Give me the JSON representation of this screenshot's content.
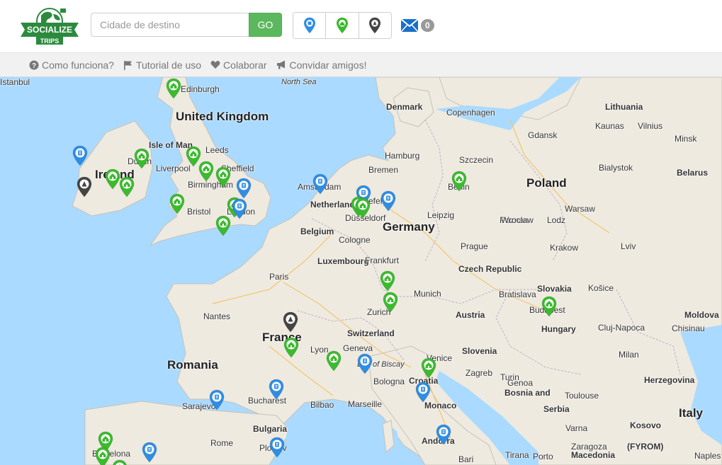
{
  "brand": {
    "logo_top": "SOCIALIZE",
    "logo_bottom": "TRIPS"
  },
  "search": {
    "placeholder": "Cidade de destino",
    "go_label": "GO"
  },
  "filters": [
    {
      "name": "hostel-filter",
      "color": "#2f8de4"
    },
    {
      "name": "home-filter",
      "color": "#3cba2f"
    },
    {
      "name": "event-filter",
      "color": "#444444"
    }
  ],
  "messages": {
    "count": "0",
    "color": "#1a6fc9"
  },
  "subnav": [
    {
      "label": "Como funciona?",
      "icon": "question-circle-icon"
    },
    {
      "label": "Tutorial de uso",
      "icon": "flag-icon"
    },
    {
      "label": "Colaborar",
      "icon": "heart-icon"
    },
    {
      "label": "Convidar amigos!",
      "icon": "bullhorn-icon"
    }
  ],
  "map": {
    "labels": [
      {
        "text": "North Sea",
        "cls": "sea"
      },
      {
        "text": "Edinburgh",
        "cls": "city"
      },
      {
        "text": "United Kingdom",
        "cls": "big"
      },
      {
        "text": "Isle of Man",
        "cls": "region"
      },
      {
        "text": "Leeds",
        "cls": "city"
      },
      {
        "text": "Dublin",
        "cls": "city"
      },
      {
        "text": "Ireland",
        "cls": "country"
      },
      {
        "text": "Liverpool",
        "cls": "city"
      },
      {
        "text": "Sheffield",
        "cls": "city"
      },
      {
        "text": "Birmingham",
        "cls": "city"
      },
      {
        "text": "Bristol",
        "cls": "city"
      },
      {
        "text": "London",
        "cls": "city"
      },
      {
        "text": "Denmark",
        "cls": "region"
      },
      {
        "text": "Copenhagen",
        "cls": "city"
      },
      {
        "text": "Lithuania",
        "cls": "region"
      },
      {
        "text": "Kaunas",
        "cls": "city"
      },
      {
        "text": "Vilnius",
        "cls": "city"
      },
      {
        "text": "Gdansk",
        "cls": "city"
      },
      {
        "text": "Minsk",
        "cls": "city"
      },
      {
        "text": "Hamburg",
        "cls": "city"
      },
      {
        "text": "Szczecin",
        "cls": "city"
      },
      {
        "text": "Bremen",
        "cls": "city"
      },
      {
        "text": "Bialystok",
        "cls": "city"
      },
      {
        "text": "Belarus",
        "cls": "region"
      },
      {
        "text": "Amsterdam",
        "cls": "city"
      },
      {
        "text": "Netherlands",
        "cls": "region"
      },
      {
        "text": "Berlin",
        "cls": "city"
      },
      {
        "text": "Poland",
        "cls": "country"
      },
      {
        "text": "Bielefeld",
        "cls": "city"
      },
      {
        "text": "Düsseldorf",
        "cls": "city"
      },
      {
        "text": "Leipzig",
        "cls": "city"
      },
      {
        "text": "Poznan",
        "cls": "city"
      },
      {
        "text": "Warsaw",
        "cls": "city"
      },
      {
        "text": "Belgium",
        "cls": "region"
      },
      {
        "text": "Germany",
        "cls": "country"
      },
      {
        "text": "Wroclaw",
        "cls": "city"
      },
      {
        "text": "Lodz",
        "cls": "city"
      },
      {
        "text": "Cologne",
        "cls": "city"
      },
      {
        "text": "Prague",
        "cls": "city"
      },
      {
        "text": "Krakow",
        "cls": "city"
      },
      {
        "text": "Lviv",
        "cls": "city"
      },
      {
        "text": "Luxembourg",
        "cls": "region"
      },
      {
        "text": "Frankfurt",
        "cls": "city"
      },
      {
        "text": "Czech Republic",
        "cls": "region"
      },
      {
        "text": "Paris",
        "cls": "city"
      },
      {
        "text": "Slovakia",
        "cls": "region"
      },
      {
        "text": "Košice",
        "cls": "city"
      },
      {
        "text": "Munich",
        "cls": "city"
      },
      {
        "text": "Bratislava",
        "cls": "city"
      },
      {
        "text": "Budapest",
        "cls": "city"
      },
      {
        "text": "Nantes",
        "cls": "city"
      },
      {
        "text": "Zurich",
        "cls": "city"
      },
      {
        "text": "Austria",
        "cls": "region"
      },
      {
        "text": "Moldova",
        "cls": "region"
      },
      {
        "text": "Hungary",
        "cls": "region"
      },
      {
        "text": "Chisinau",
        "cls": "city"
      },
      {
        "text": "Cluj-Napoca",
        "cls": "city"
      },
      {
        "text": "Switzerland",
        "cls": "region"
      },
      {
        "text": "France",
        "cls": "country"
      },
      {
        "text": "Geneva",
        "cls": "city"
      },
      {
        "text": "Lyon",
        "cls": "city"
      },
      {
        "text": "Slovenia",
        "cls": "region"
      },
      {
        "text": "Venice",
        "cls": "city"
      },
      {
        "text": "Milan",
        "cls": "city"
      },
      {
        "text": "Romania",
        "cls": "country"
      },
      {
        "text": "Bay of Biscay",
        "cls": "sea"
      },
      {
        "text": "Turin",
        "cls": "city"
      },
      {
        "text": "Zagreb",
        "cls": "city"
      },
      {
        "text": "Croatia",
        "cls": "region"
      },
      {
        "text": "Bologna",
        "cls": "city"
      },
      {
        "text": "Genoa",
        "cls": "city"
      },
      {
        "text": "Bosnia and",
        "cls": "region"
      },
      {
        "text": "Herzegovina",
        "cls": "region"
      },
      {
        "text": "Bucharest",
        "cls": "city"
      },
      {
        "text": "Toulouse",
        "cls": "city"
      },
      {
        "text": "Serbia",
        "cls": "region"
      },
      {
        "text": "Sarajevo",
        "cls": "city"
      },
      {
        "text": "Bilbao",
        "cls": "city"
      },
      {
        "text": "Marseille",
        "cls": "city"
      },
      {
        "text": "Monaco",
        "cls": "region"
      },
      {
        "text": "Italy",
        "cls": "country"
      },
      {
        "text": "Varna",
        "cls": "city"
      },
      {
        "text": "Kosovo",
        "cls": "region"
      },
      {
        "text": "Bulgaria",
        "cls": "region"
      },
      {
        "text": "Andorra",
        "cls": "region"
      },
      {
        "text": "Rome",
        "cls": "city"
      },
      {
        "text": "Zaragoza",
        "cls": "city"
      },
      {
        "text": "Macedonia",
        "cls": "region"
      },
      {
        "text": "(FYROM)",
        "cls": "region"
      },
      {
        "text": "Plovdiv",
        "cls": "city"
      },
      {
        "text": "Barcelona",
        "cls": "city"
      },
      {
        "text": "Porto",
        "cls": "city"
      },
      {
        "text": "Tirana",
        "cls": "city"
      },
      {
        "text": "Bari",
        "cls": "city"
      },
      {
        "text": "Naples",
        "cls": "city"
      },
      {
        "text": "Istanbul",
        "cls": "city"
      }
    ],
    "markers": [
      {
        "type": "green"
      },
      {
        "type": "blue"
      },
      {
        "type": "green"
      },
      {
        "type": "green"
      },
      {
        "type": "green"
      },
      {
        "type": "green"
      },
      {
        "type": "dark"
      },
      {
        "type": "green"
      },
      {
        "type": "green"
      },
      {
        "type": "blue"
      },
      {
        "type": "green"
      },
      {
        "type": "green"
      },
      {
        "type": "blue"
      },
      {
        "type": "green"
      },
      {
        "type": "blue"
      },
      {
        "type": "green"
      },
      {
        "type": "blue"
      },
      {
        "type": "green"
      },
      {
        "type": "green"
      },
      {
        "type": "blue"
      },
      {
        "type": "green"
      },
      {
        "type": "green"
      },
      {
        "type": "green"
      },
      {
        "type": "dark"
      },
      {
        "type": "green"
      },
      {
        "type": "green"
      },
      {
        "type": "blue"
      },
      {
        "type": "green"
      },
      {
        "type": "blue"
      },
      {
        "type": "blue"
      },
      {
        "type": "blue"
      },
      {
        "type": "blue"
      },
      {
        "type": "blue"
      },
      {
        "type": "green"
      },
      {
        "type": "green"
      },
      {
        "type": "green"
      },
      {
        "type": "blue"
      }
    ]
  }
}
